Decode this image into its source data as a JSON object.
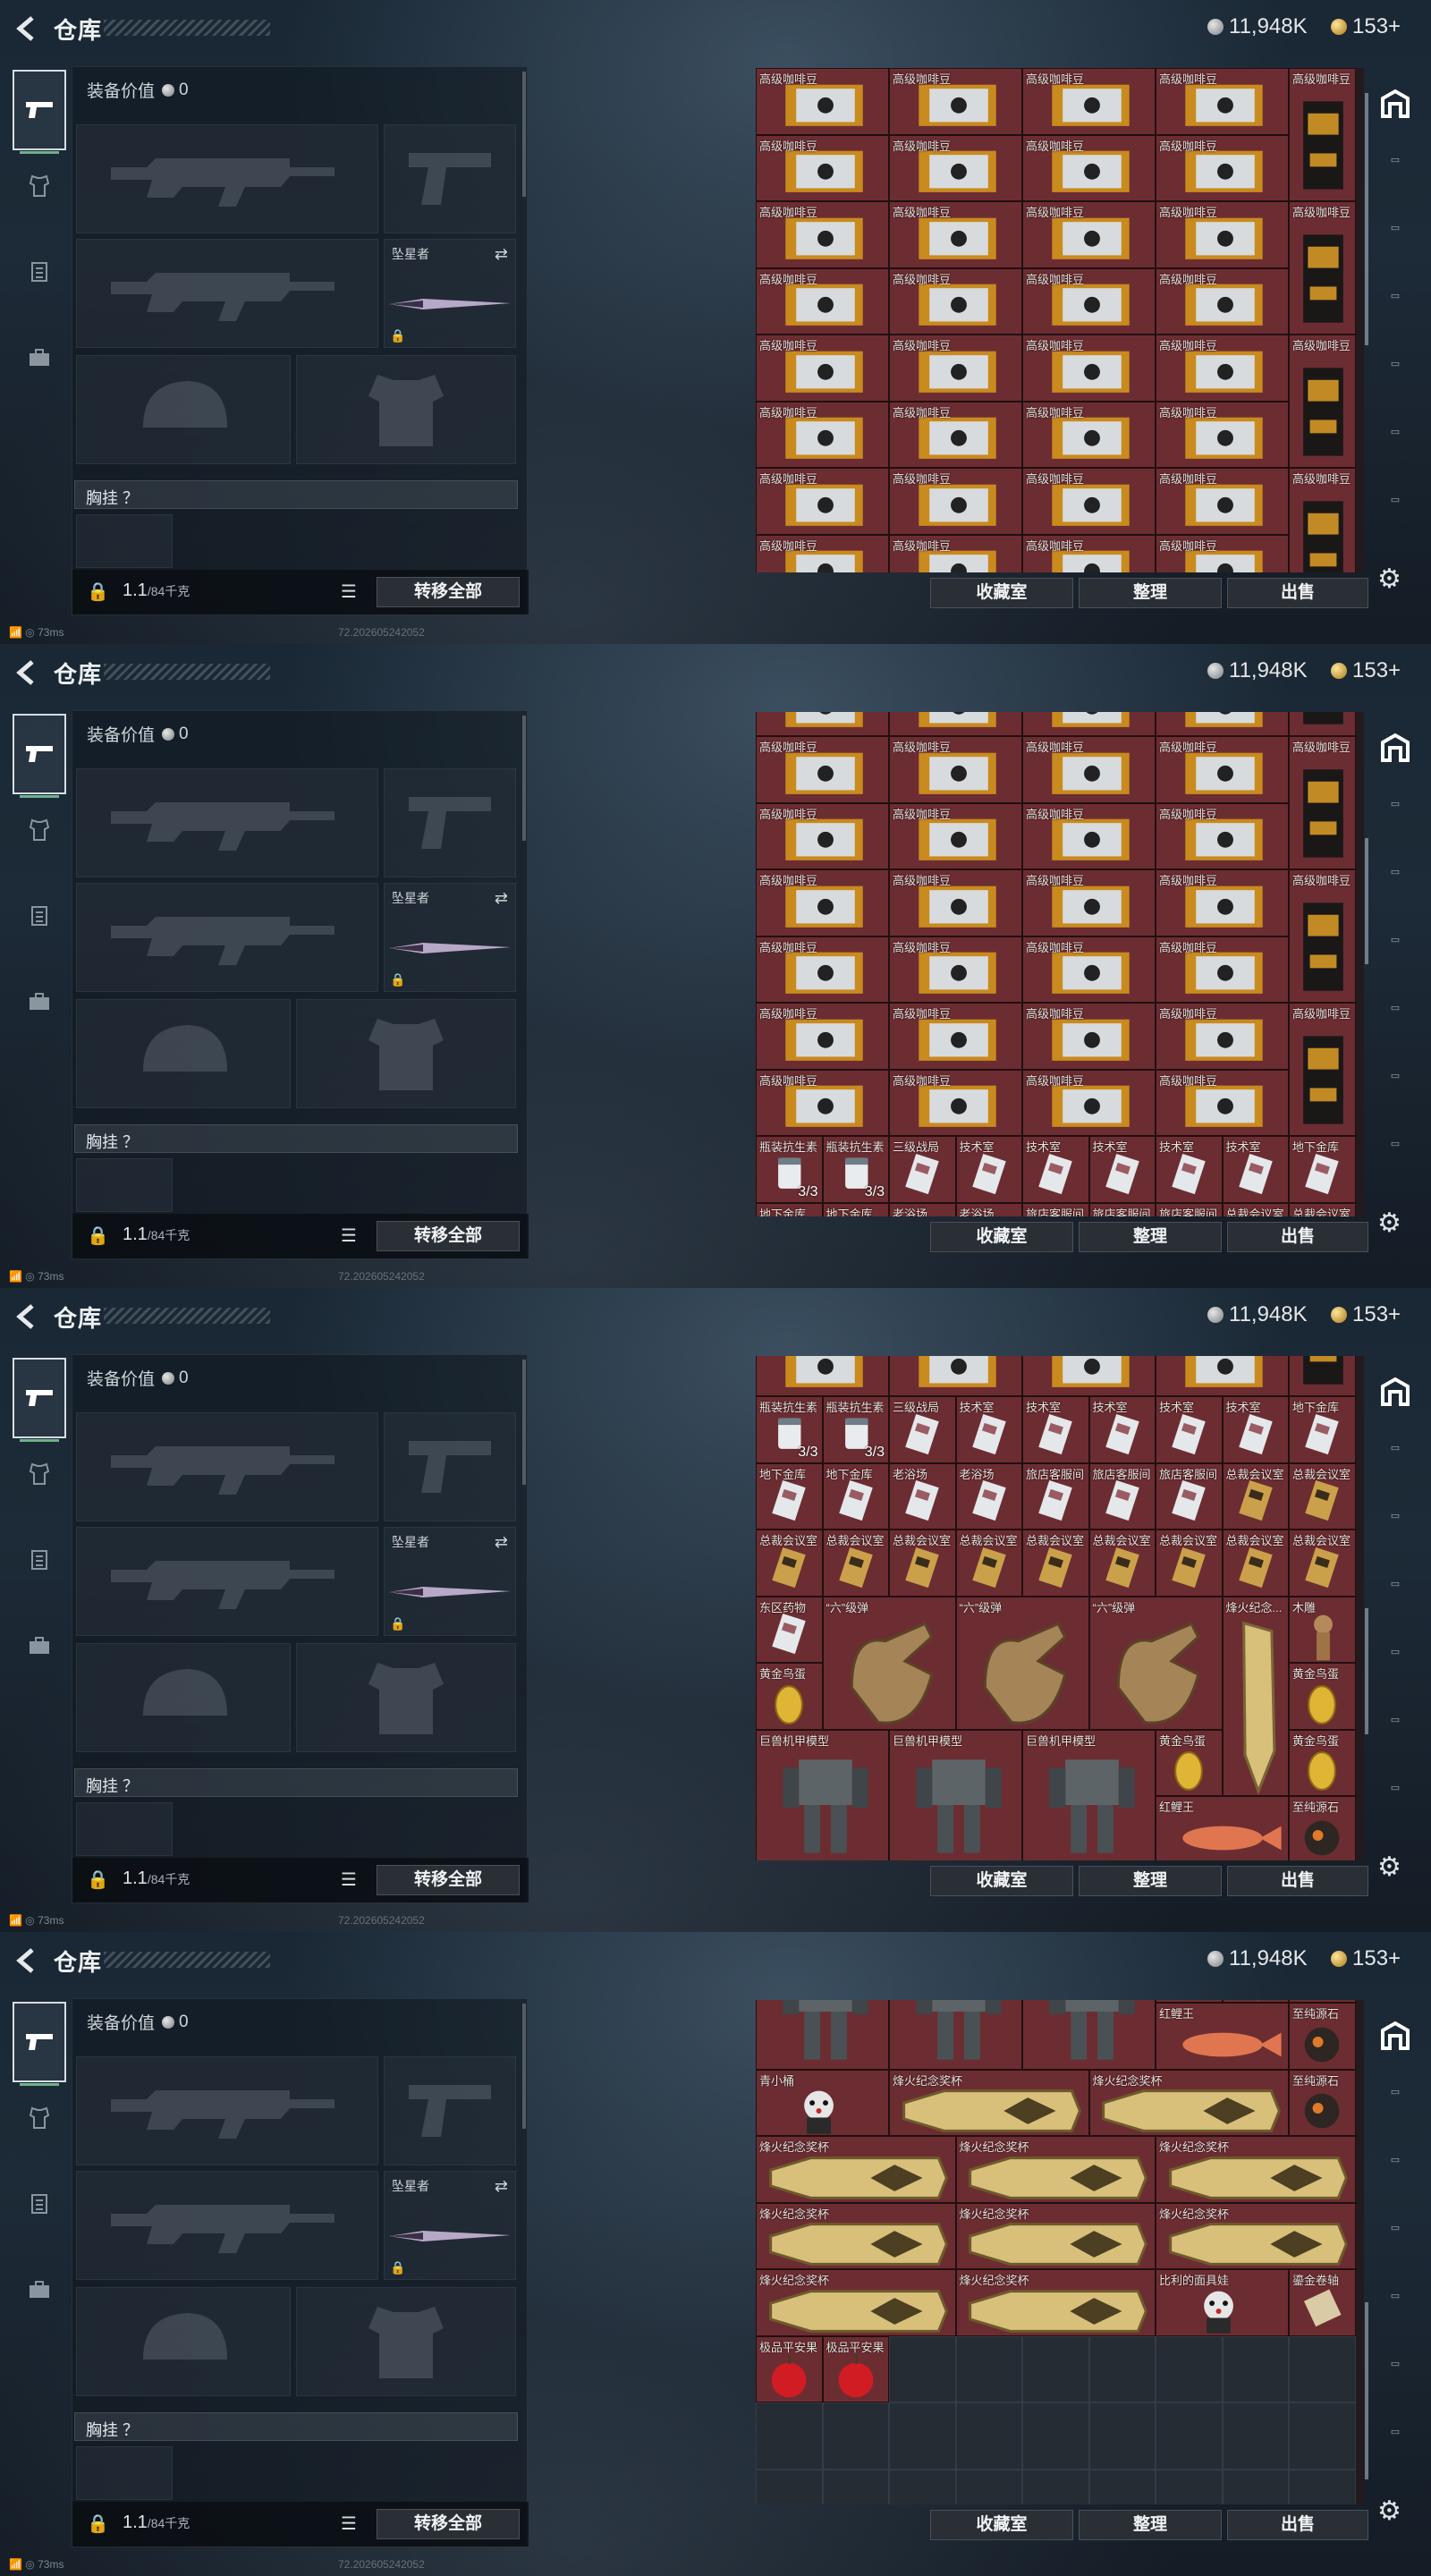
{
  "header": {
    "title": "仓库",
    "silver": "11,948K",
    "gold": "153+"
  },
  "loadout": {
    "equip_value_label": "装备价值",
    "equip_value": "0",
    "melee_name": "坠星者",
    "vest_label": "胸挂 ？",
    "weight": "1.1",
    "weight_max": "/84千克",
    "transfer_all": "转移全部"
  },
  "actions": {
    "collection": "收藏室",
    "sort": "整理",
    "sell": "出售"
  },
  "status": {
    "ping": "73ms",
    "build": "72.202605242052"
  },
  "icons": {
    "back": "chevron-left-icon",
    "currency_silver": "silver-coin-icon",
    "currency_gold": "gold-coin-icon",
    "settings": "gear-icon"
  },
  "colors": {
    "item_bg": "#6c2d32",
    "empty_cell": "#262c33",
    "accent": "#6fb28b"
  },
  "views": [
    {
      "scroll": 0,
      "scrollbar": [
        0.05,
        0.55
      ]
    },
    {
      "scroll": 0.1,
      "scrollbar": [
        0.25,
        0.5
      ]
    },
    {
      "scroll": 0.45,
      "scrollbar": [
        0.5,
        0.75
      ]
    },
    {
      "scroll": 0.85,
      "scrollbar": [
        0.6,
        0.95
      ]
    }
  ],
  "inventory": {
    "cols": 9,
    "items": [
      {
        "label": "高级咖啡豆",
        "w": 2,
        "h": 1,
        "kind": "coffee"
      },
      {
        "label": "高级咖啡豆",
        "w": 2,
        "h": 1,
        "kind": "coffee"
      },
      {
        "label": "高级咖啡豆",
        "w": 2,
        "h": 1,
        "kind": "coffee"
      },
      {
        "label": "高级咖啡豆",
        "w": 2,
        "h": 1,
        "kind": "coffee"
      },
      {
        "label": "高级咖啡豆",
        "w": 1,
        "h": 2,
        "kind": "bag"
      },
      {
        "label": "高级咖啡豆",
        "w": 2,
        "h": 1,
        "kind": "coffee"
      },
      {
        "label": "高级咖啡豆",
        "w": 2,
        "h": 1,
        "kind": "coffee"
      },
      {
        "label": "高级咖啡豆",
        "w": 2,
        "h": 1,
        "kind": "coffee"
      },
      {
        "label": "高级咖啡豆",
        "w": 2,
        "h": 1,
        "kind": "coffee"
      },
      {
        "label": "高级咖啡豆",
        "w": 2,
        "h": 1,
        "kind": "coffee"
      },
      {
        "label": "高级咖啡豆",
        "w": 2,
        "h": 1,
        "kind": "coffee"
      },
      {
        "label": "高级咖啡豆",
        "w": 2,
        "h": 1,
        "kind": "coffee"
      },
      {
        "label": "高级咖啡豆",
        "w": 2,
        "h": 1,
        "kind": "coffee"
      },
      {
        "label": "高级咖啡豆",
        "w": 1,
        "h": 2,
        "kind": "bag"
      },
      {
        "label": "高级咖啡豆",
        "w": 2,
        "h": 1,
        "kind": "coffee"
      },
      {
        "label": "高级咖啡豆",
        "w": 2,
        "h": 1,
        "kind": "coffee"
      },
      {
        "label": "高级咖啡豆",
        "w": 2,
        "h": 1,
        "kind": "coffee"
      },
      {
        "label": "高级咖啡豆",
        "w": 2,
        "h": 1,
        "kind": "coffee"
      },
      {
        "label": "高级咖啡豆",
        "w": 2,
        "h": 1,
        "kind": "coffee"
      },
      {
        "label": "高级咖啡豆",
        "w": 2,
        "h": 1,
        "kind": "coffee"
      },
      {
        "label": "高级咖啡豆",
        "w": 2,
        "h": 1,
        "kind": "coffee"
      },
      {
        "label": "高级咖啡豆",
        "w": 2,
        "h": 1,
        "kind": "coffee"
      },
      {
        "label": "高级咖啡豆",
        "w": 1,
        "h": 2,
        "kind": "bag"
      },
      {
        "label": "高级咖啡豆",
        "w": 2,
        "h": 1,
        "kind": "coffee"
      },
      {
        "label": "高级咖啡豆",
        "w": 2,
        "h": 1,
        "kind": "coffee"
      },
      {
        "label": "高级咖啡豆",
        "w": 2,
        "h": 1,
        "kind": "coffee"
      },
      {
        "label": "高级咖啡豆",
        "w": 2,
        "h": 1,
        "kind": "coffee"
      },
      {
        "label": "高级咖啡豆",
        "w": 2,
        "h": 1,
        "kind": "coffee"
      },
      {
        "label": "高级咖啡豆",
        "w": 2,
        "h": 1,
        "kind": "coffee"
      },
      {
        "label": "高级咖啡豆",
        "w": 2,
        "h": 1,
        "kind": "coffee"
      },
      {
        "label": "高级咖啡豆",
        "w": 2,
        "h": 1,
        "kind": "coffee"
      },
      {
        "label": "高级咖啡豆",
        "w": 1,
        "h": 2,
        "kind": "bag"
      },
      {
        "label": "高级咖啡豆",
        "w": 2,
        "h": 1,
        "kind": "coffee"
      },
      {
        "label": "高级咖啡豆",
        "w": 2,
        "h": 1,
        "kind": "coffee"
      },
      {
        "label": "高级咖啡豆",
        "w": 2,
        "h": 1,
        "kind": "coffee"
      },
      {
        "label": "高级咖啡豆",
        "w": 2,
        "h": 1,
        "kind": "coffee"
      },
      {
        "label": "瓶装抗生素",
        "w": 1,
        "h": 1,
        "kind": "pill",
        "count": "3/3"
      },
      {
        "label": "瓶装抗生素",
        "w": 1,
        "h": 1,
        "kind": "pill",
        "count": "3/3"
      },
      {
        "label": "三级战局",
        "w": 1,
        "h": 1,
        "kind": "card"
      },
      {
        "label": "技术室",
        "w": 1,
        "h": 1,
        "kind": "card"
      },
      {
        "label": "技术室",
        "w": 1,
        "h": 1,
        "kind": "card"
      },
      {
        "label": "技术室",
        "w": 1,
        "h": 1,
        "kind": "card"
      },
      {
        "label": "技术室",
        "w": 1,
        "h": 1,
        "kind": "card"
      },
      {
        "label": "技术室",
        "w": 1,
        "h": 1,
        "kind": "card"
      },
      {
        "label": "地下金库",
        "w": 1,
        "h": 1,
        "kind": "card"
      },
      {
        "label": "地下金库",
        "w": 1,
        "h": 1,
        "kind": "card"
      },
      {
        "label": "地下金库",
        "w": 1,
        "h": 1,
        "kind": "card"
      },
      {
        "label": "老浴场",
        "w": 1,
        "h": 1,
        "kind": "card"
      },
      {
        "label": "老浴场",
        "w": 1,
        "h": 1,
        "kind": "card"
      },
      {
        "label": "旅店客服间",
        "w": 1,
        "h": 1,
        "kind": "card"
      },
      {
        "label": "旅店客服间",
        "w": 1,
        "h": 1,
        "kind": "card"
      },
      {
        "label": "旅店客服间",
        "w": 1,
        "h": 1,
        "kind": "card"
      },
      {
        "label": "总裁会议室",
        "w": 1,
        "h": 1,
        "kind": "goldcard"
      },
      {
        "label": "总裁会议室",
        "w": 1,
        "h": 1,
        "kind": "goldcard"
      },
      {
        "label": "总裁会议室",
        "w": 1,
        "h": 1,
        "kind": "goldcard"
      },
      {
        "label": "总裁会议室",
        "w": 1,
        "h": 1,
        "kind": "goldcard"
      },
      {
        "label": "总裁会议室",
        "w": 1,
        "h": 1,
        "kind": "goldcard"
      },
      {
        "label": "总裁会议室",
        "w": 1,
        "h": 1,
        "kind": "goldcard"
      },
      {
        "label": "总裁会议室",
        "w": 1,
        "h": 1,
        "kind": "goldcard"
      },
      {
        "label": "总裁会议室",
        "w": 1,
        "h": 1,
        "kind": "goldcard"
      },
      {
        "label": "总裁会议室",
        "w": 1,
        "h": 1,
        "kind": "goldcard"
      },
      {
        "label": "总裁会议室",
        "w": 1,
        "h": 1,
        "kind": "goldcard"
      },
      {
        "label": "总裁会议室",
        "w": 1,
        "h": 1,
        "kind": "goldcard"
      },
      {
        "label": "东区药物",
        "w": 1,
        "h": 1,
        "kind": "card"
      },
      {
        "label": "“六”级弹",
        "w": 2,
        "h": 2,
        "kind": "hand"
      },
      {
        "label": "“六”级弹",
        "w": 2,
        "h": 2,
        "kind": "hand"
      },
      {
        "label": "“六”级弹",
        "w": 2,
        "h": 2,
        "kind": "hand"
      },
      {
        "label": "烽火纪念...",
        "w": 1,
        "h": 3,
        "kind": "trophy"
      },
      {
        "label": "巨兽机甲模型",
        "w": 2,
        "h": 2,
        "kind": "mech"
      },
      {
        "label": "巨兽机甲模型",
        "w": 2,
        "h": 2,
        "kind": "mech"
      },
      {
        "label": "巨兽机甲模型",
        "w": 2,
        "h": 2,
        "kind": "mech"
      },
      {
        "label": "红鲤王",
        "w": 2,
        "h": 1,
        "kind": "fish"
      },
      {
        "label": "青小桶",
        "w": 2,
        "h": 1,
        "kind": "doll"
      },
      {
        "label": "烽火纪念奖杯",
        "w": 3,
        "h": 1,
        "kind": "cup"
      },
      {
        "label": "烽火纪念奖杯",
        "w": 3,
        "h": 1,
        "kind": "cup"
      },
      {
        "label": "烽火纪念奖杯",
        "w": 3,
        "h": 1,
        "kind": "cup"
      },
      {
        "label": "烽火纪念奖杯",
        "w": 3,
        "h": 1,
        "kind": "cup"
      },
      {
        "label": "烽火纪念奖杯",
        "w": 3,
        "h": 1,
        "kind": "cup"
      },
      {
        "label": "烽火纪念奖杯",
        "w": 3,
        "h": 1,
        "kind": "cup"
      },
      {
        "label": "烽火纪念奖杯",
        "w": 3,
        "h": 1,
        "kind": "cup"
      },
      {
        "label": "烽火纪念奖杯",
        "w": 3,
        "h": 1,
        "kind": "cup"
      },
      {
        "label": "烽火纪念奖杯",
        "w": 3,
        "h": 1,
        "kind": "cup"
      },
      {
        "label": "烽火纪念奖杯",
        "w": 3,
        "h": 1,
        "kind": "cup"
      },
      {
        "label": "比利的面具娃",
        "w": 2,
        "h": 1,
        "kind": "doll"
      },
      {
        "label": "木雕",
        "w": 1,
        "h": 1,
        "kind": "statue"
      },
      {
        "label": "黄金鸟蛋",
        "w": 1,
        "h": 1,
        "kind": "egg"
      },
      {
        "label": "黄金鸟蛋",
        "w": 1,
        "h": 1,
        "kind": "egg"
      },
      {
        "label": "黄金鸟蛋",
        "w": 1,
        "h": 1,
        "kind": "egg"
      },
      {
        "label": "黄金鸟蛋",
        "w": 1,
        "h": 1,
        "kind": "egg"
      },
      {
        "label": "至纯源石",
        "w": 1,
        "h": 1,
        "kind": "ore"
      },
      {
        "label": "至纯源石",
        "w": 1,
        "h": 1,
        "kind": "ore"
      },
      {
        "label": "鎏金卷轴",
        "w": 1,
        "h": 1,
        "kind": "scroll"
      },
      {
        "label": "极品平安果",
        "w": 1,
        "h": 1,
        "kind": "apple"
      },
      {
        "label": "极品平安果",
        "w": 1,
        "h": 1,
        "kind": "apple"
      }
    ]
  }
}
